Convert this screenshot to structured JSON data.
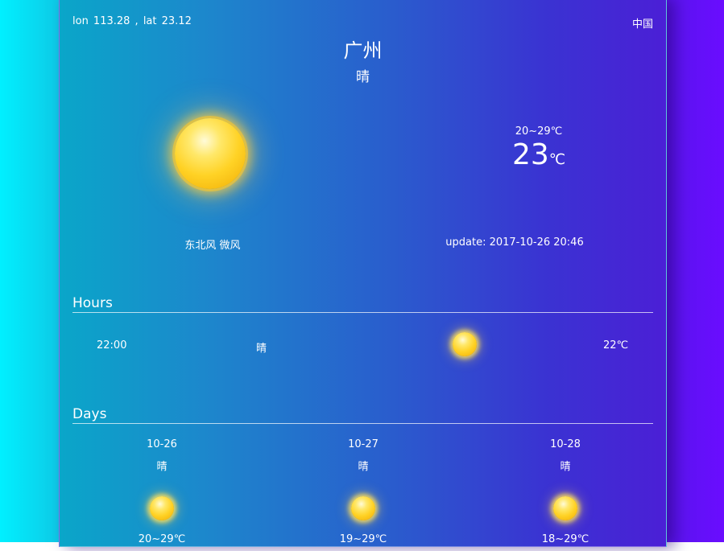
{
  "location": {
    "coords": "lon  113.28 , lat  23.12",
    "country": "中国",
    "city": "广州",
    "condition": "晴"
  },
  "current": {
    "icon": "sun-icon",
    "temp_range": "20~29℃",
    "temp": "23",
    "temp_unit": "℃",
    "wind": "东北风 微风",
    "update": "update: 2017-10-26 20:46"
  },
  "hours": {
    "title": "Hours",
    "items": [
      {
        "time": "22:00",
        "condition": "晴",
        "icon": "sun-icon",
        "temp": "22℃"
      }
    ]
  },
  "days": {
    "title": "Days",
    "items": [
      {
        "date": "10-26",
        "condition": "晴",
        "icon": "sun-icon",
        "range": "20~29℃"
      },
      {
        "date": "10-27",
        "condition": "晴",
        "icon": "sun-icon",
        "range": "19~29℃"
      },
      {
        "date": "10-28",
        "condition": "晴",
        "icon": "sun-icon",
        "range": "18~29℃"
      }
    ]
  },
  "colors": {
    "background_left": "#00f0ff",
    "background_right": "#6a0cff",
    "sun": "#ffd225"
  }
}
